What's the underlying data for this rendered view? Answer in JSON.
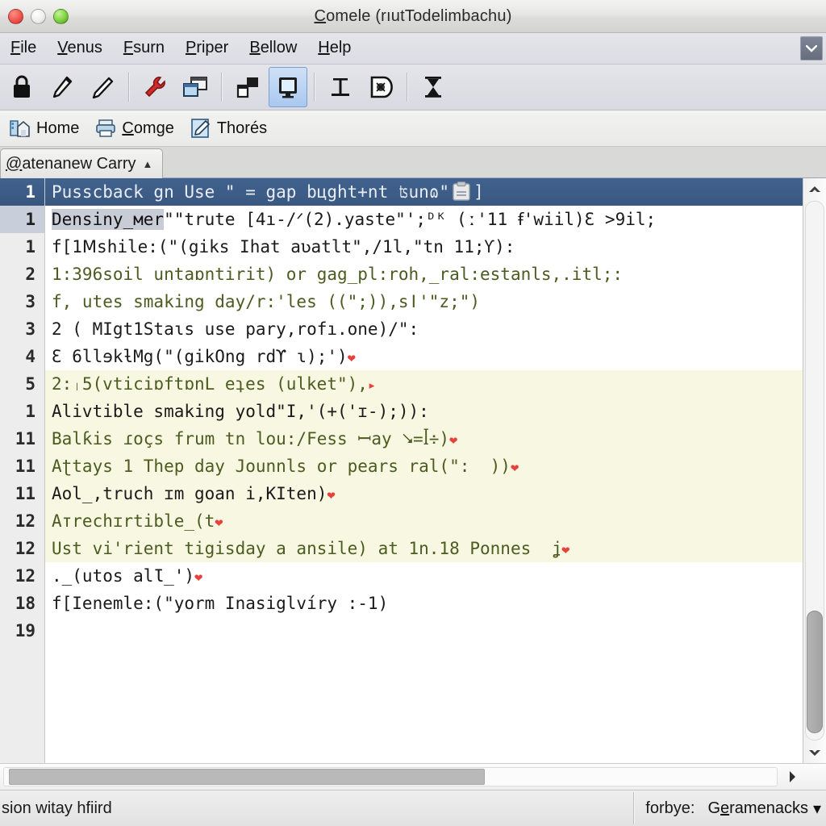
{
  "window": {
    "title": "Comele (rıutTodelimbachu)",
    "title_accel": "C",
    "buttons": {
      "close": "close",
      "minimize": "minimize",
      "maximize": "maximize"
    }
  },
  "menubar": {
    "items": [
      {
        "label": "File",
        "accel": "F"
      },
      {
        "label": "Venus",
        "accel": "V"
      },
      {
        "label": "Fsurn",
        "accel": "F"
      },
      {
        "label": "Priper",
        "accel": "P"
      },
      {
        "label": "Bellow",
        "accel": "B"
      },
      {
        "label": "Help",
        "accel": "H"
      }
    ],
    "overflow_icon": "chevron-down-icon"
  },
  "toolbar": {
    "items": [
      {
        "icon": "lock-icon",
        "active": false
      },
      {
        "icon": "pen-left-icon",
        "active": false
      },
      {
        "icon": "pen-right-icon",
        "active": false
      },
      {
        "icon": "wrench-icon",
        "active": false
      },
      {
        "icon": "window-copy-icon",
        "active": false
      },
      {
        "icon": "window-split-icon",
        "active": false
      },
      {
        "icon": "monitor-icon",
        "active": true
      },
      {
        "icon": "column-icon",
        "active": false
      },
      {
        "icon": "shield-bug-icon",
        "active": false
      },
      {
        "icon": "hourglass-icon",
        "active": false
      }
    ]
  },
  "bookmarkbar": {
    "items": [
      {
        "label": "Home",
        "accel": "",
        "icon": "house-icon"
      },
      {
        "label": "Comge",
        "accel": "C",
        "icon": "printer-icon"
      },
      {
        "label": "Thorés",
        "accel": "",
        "icon": "note-pen-icon"
      }
    ]
  },
  "tabs": [
    {
      "label": "@atenanew Carry",
      "accel": "@",
      "caret": "▲",
      "active": true
    }
  ],
  "editor": {
    "gutter": [
      "1",
      "1",
      "1",
      "2",
      "3",
      "3",
      "4",
      "5",
      "1",
      "11",
      "11",
      "11",
      "12",
      "12",
      "12",
      "18",
      "19"
    ],
    "lines": [
      {
        "style": "selrow",
        "segments": [
          {
            "text": "Pusscback gn Use \" = gap bцght+nt ʦunɷ\""
          },
          {
            "icon": "clipboard-icon"
          },
          {
            "text": "]"
          }
        ]
      },
      {
        "style": "plain",
        "segments": [
          {
            "text": "Densiny_мer",
            "select": true
          },
          {
            "text": "\"\"trute [4ı-/ᐟ(2).yaste\"ꞌ;ᴰᴷ (ː'11 ꞙ'wiil)Ɛ >9il;"
          }
        ]
      },
      {
        "style": "plain",
        "segments": [
          {
            "text": "f[1Ⅿshile:(\"(giks Ihat aʋatlt\",/1l,\"tn 11;Ƴ):"
          }
        ]
      },
      {
        "style": "green",
        "segments": [
          {
            "text": "1:396soil untaɒntirit) or gag_pl:roh,_ral:estanls,.itl;:"
          }
        ]
      },
      {
        "style": "green",
        "segments": [
          {
            "text": "f, utes smaking day/r:'les ((\";)),sǀ'\"z;\")"
          }
        ]
      },
      {
        "style": "plain",
        "segments": [
          {
            "text": "2 ( MIgt1Staɩs use pary,rofı.one)/\":"
          }
        ]
      },
      {
        "style": "plain",
        "segments": [
          {
            "text": "Ɛ 6llɘkƚMg(\"(gikOng rdϒ ɩ);ꞌ)"
          },
          {
            "heart": true
          }
        ]
      },
      {
        "style": "hl green",
        "segments": [
          {
            "text": "2:ᛧ5(vticiɒftɒnL eʇes (ulket\"),"
          },
          {
            "arrow": true
          }
        ]
      },
      {
        "style": "hl plain",
        "segments": [
          {
            "text": "Alivtible smaking yold\"I,'(+('ɪ-);)):"
          }
        ]
      },
      {
        "style": "hl green",
        "segments": [
          {
            "text": "Balƙis ɾoçs frum tn lou:/Fess ꟷay ⭨=ꟾ÷)"
          },
          {
            "heart": true
          }
        ]
      },
      {
        "style": "hl green",
        "segments": [
          {
            "text": "Aʈtays 1 Thep day Jounnls or pears ral(\":  ))"
          },
          {
            "heart": true
          }
        ]
      },
      {
        "style": "hl plain",
        "segments": [
          {
            "text": "Aol_,truch ɪm goan i,KIten)"
          },
          {
            "heart": true
          }
        ]
      },
      {
        "style": "hl green",
        "segments": [
          {
            "text": "Aтrechɪrtible_(t"
          },
          {
            "heart": true
          }
        ]
      },
      {
        "style": "hl green",
        "segments": [
          {
            "text": "Ust viꞌrient tigisday a ansile) at 1n.18 Ponnes  ʝ"
          },
          {
            "heart": true
          }
        ]
      },
      {
        "style": "plain",
        "segments": [
          {
            "text": "._(utos alƖ_')"
          },
          {
            "heart": true
          }
        ]
      },
      {
        "style": "plain",
        "segments": [
          {
            "text": "f[Ienemle:(\"yorm Inasiglvíry :-1)"
          }
        ]
      },
      {
        "style": "plain",
        "segments": [
          {
            "text": ""
          }
        ]
      }
    ],
    "vscroll": {
      "up": "scroll-up-arrow",
      "down": "scroll-down-arrow"
    },
    "hscroll": {
      "right": "scroll-right-arrow"
    }
  },
  "statusbar": {
    "left_text": "sion witay hfiird",
    "right_label": "forbye:",
    "combo_value": "Geramenacks",
    "combo_accel": "e",
    "combo_caret": "▾"
  },
  "colors": {
    "selection_blue": "#41628f",
    "highlight_yellow": "#f7f7e2",
    "code_green": "#4b5c20",
    "heart_red": "#e8403a",
    "chrome_gray": "#e4e4ea"
  }
}
